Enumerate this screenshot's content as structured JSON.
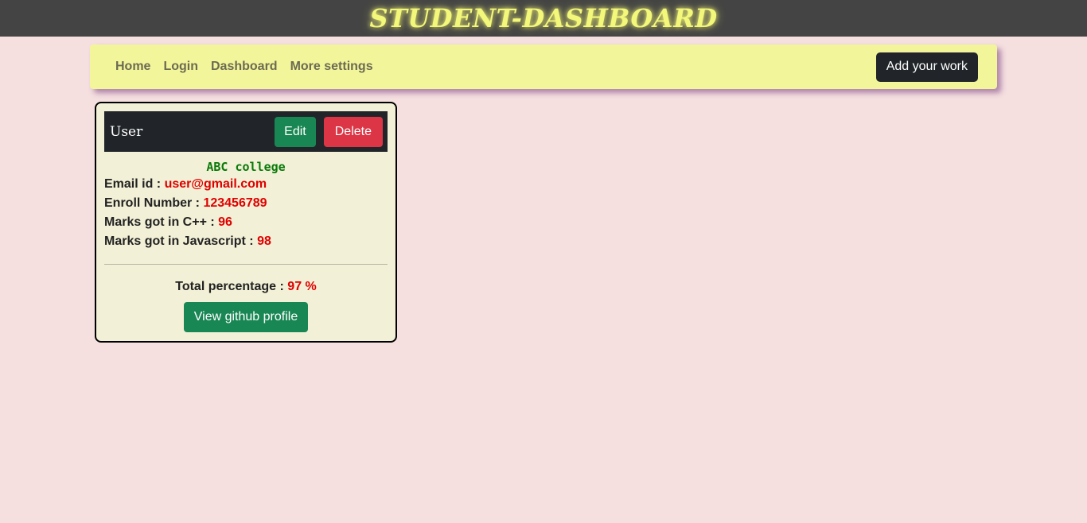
{
  "header": {
    "brand": "STUDENT-DASHBOARD"
  },
  "navbar": {
    "links": [
      "Home",
      "Login",
      "Dashboard",
      "More settings"
    ],
    "add_work_label": "Add your work"
  },
  "card": {
    "title": "User",
    "edit_label": "Edit",
    "delete_label": "Delete",
    "college": "ABC college",
    "email_label": "Email id : ",
    "email_value": "user@gmail.com",
    "enroll_label": "Enroll Number : ",
    "enroll_value": "123456789",
    "cpp_label": "Marks got in C++ : ",
    "cpp_value": "96",
    "js_label": "Marks got in Javascript : ",
    "js_value": "98",
    "total_label": "Total percentage : ",
    "total_value": "97 %",
    "github_label": "View github profile"
  },
  "colors": {
    "page_bg": "#f5dfdf",
    "topbar_bg": "#444444",
    "brand": "#f3f77a",
    "navbar_bg": "#f3f59a",
    "card_bg": "#f2f0d6",
    "card_header_bg": "#212529",
    "success": "#198754",
    "danger": "#dc3545",
    "value_red": "#e00000",
    "college_green": "#0a7a0a"
  }
}
